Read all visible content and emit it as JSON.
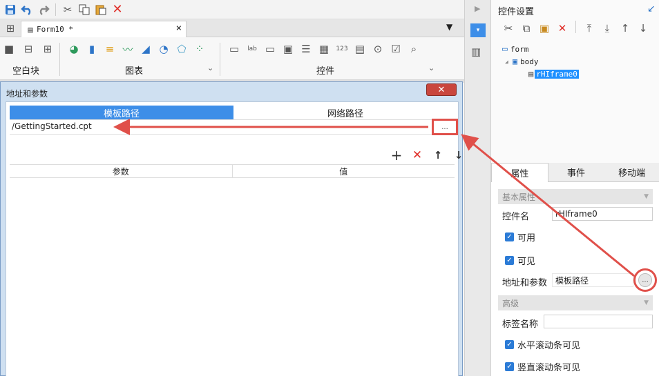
{
  "top_toolbar": {
    "icons": [
      "save-icon",
      "undo-icon",
      "redo-icon",
      "cut-icon",
      "copy-icon",
      "paste-icon",
      "delete-icon"
    ]
  },
  "tab": {
    "title": "Form10 *",
    "close": "×"
  },
  "ribbon": {
    "group_blank": "空白块",
    "group_chart": "图表",
    "group_widget": "控件"
  },
  "right_panel": {
    "title": "控件设置",
    "tree": {
      "form": "form",
      "body": "body",
      "selected": "rHIframe0"
    },
    "tabs": [
      "属性",
      "事件",
      "移动端"
    ],
    "section_basic": "基本属性",
    "name_label": "控件名",
    "name_value": "rHIframe0",
    "enabled_label": "可用",
    "visible_label": "可见",
    "url_label": "地址和参数",
    "url_value": "模板路径",
    "url_button": "...",
    "section_advanced": "高级",
    "tag_label": "标签名称",
    "tag_value": "",
    "hscroll_label": "水平滚动条可见",
    "vscroll_label": "竖直滚动条可见"
  },
  "dialog": {
    "title": "地址和参数",
    "tab_template": "模板路径",
    "tab_network": "网络路径",
    "path_value": "/GettingStarted.cpt",
    "browse_button": "...",
    "col_param": "参数",
    "col_value": "值"
  },
  "colors": {
    "accent": "#3d8ee8",
    "annotation": "#e0504a",
    "danger": "#e0302a"
  }
}
